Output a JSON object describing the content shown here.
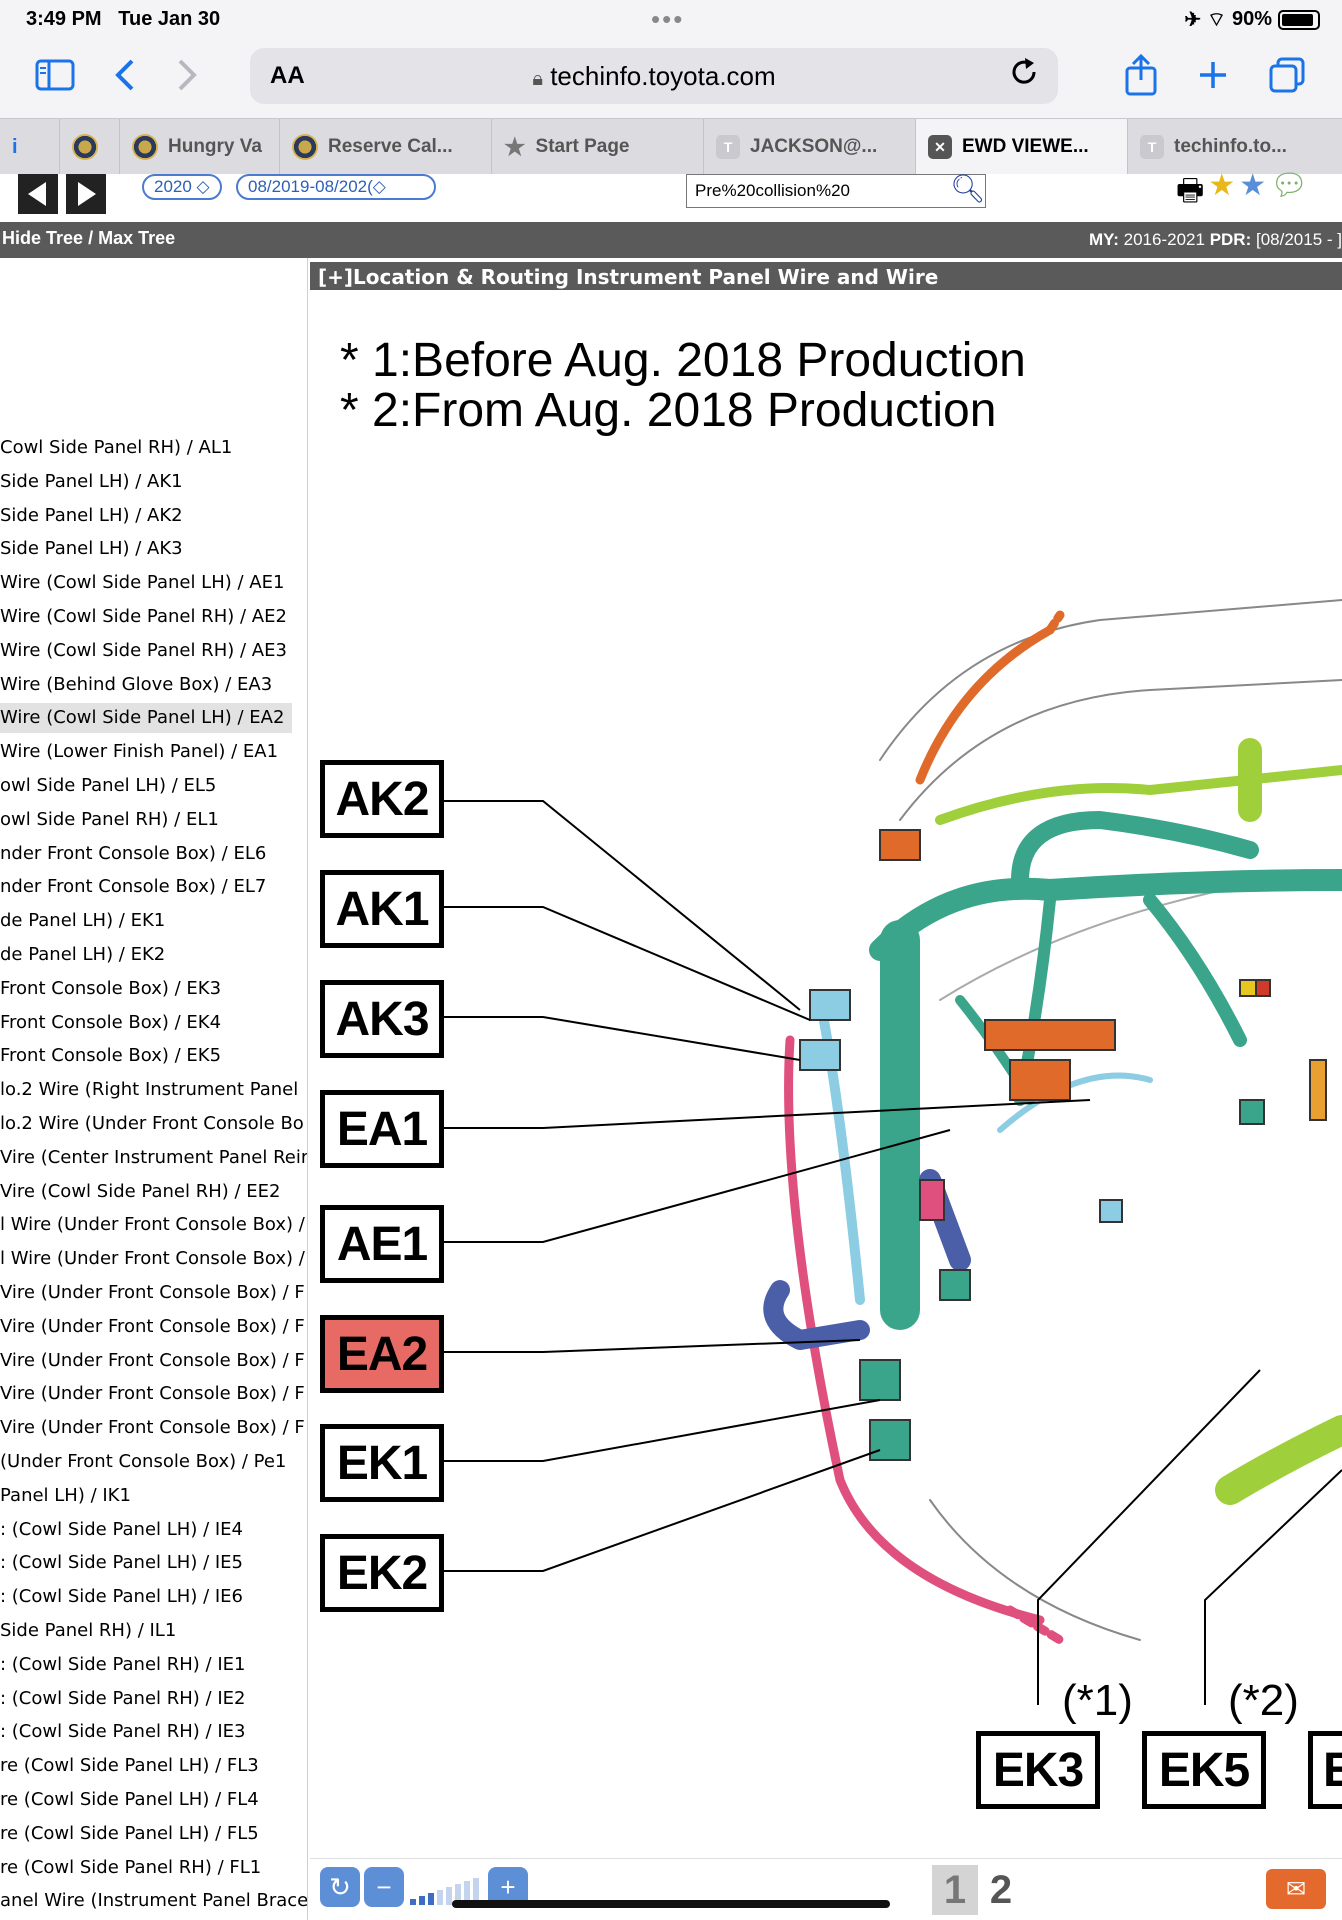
{
  "status_bar": {
    "time": "3:49 PM",
    "date": "Tue Jan 30",
    "battery": "90%",
    "battery_level": 0.9
  },
  "browser": {
    "text_size_label": "AA",
    "url": "techinfo.toyota.com",
    "tabs": [
      {
        "label": "Hungry Va"
      },
      {
        "label": "Reserve Cal..."
      },
      {
        "label": "Start Page"
      },
      {
        "label": "JACKSON@..."
      },
      {
        "label": "EWD VIEWE..."
      },
      {
        "label": "techinfo.to..."
      }
    ]
  },
  "app_nav": {
    "year": "2020 ◇",
    "range": "08/2019-08/202(◇",
    "search_value": "Pre%20collision%20"
  },
  "tree_bar": {
    "hide_tree": "Hide Tree",
    "separator": "/",
    "max_tree": "Max Tree",
    "my_label": "MY:",
    "my_value": "2016-2021",
    "pdr_label": "PDR:",
    "pdr_value": "[08/2015 - ]"
  },
  "sidebar": {
    "items": [
      "Cowl Side Panel RH) / AL1",
      "Side Panel LH) / AK1",
      "Side Panel LH) / AK2",
      "Side Panel LH) / AK3",
      " Wire (Cowl Side Panel LH) / AE1",
      " Wire (Cowl Side Panel RH) / AE2",
      " Wire (Cowl Side Panel RH) / AE3",
      " Wire (Behind Glove Box) / EA3",
      " Wire (Cowl Side Panel LH) / EA2",
      " Wire (Lower Finish Panel) / EA1",
      "owl Side Panel LH) / EL5",
      "owl Side Panel RH) / EL1",
      "nder Front Console Box) / EL6",
      "nder Front Console Box) / EL7",
      "de Panel LH) / EK1",
      "de Panel LH) / EK2",
      "Front Console Box) / EK3",
      "Front Console Box) / EK4",
      "Front Console Box) / EK5",
      "lo.2 Wire (Right Instrument Panel",
      "lo.2 Wire (Under Front Console Bo",
      "Vire (Center Instrument Panel Reir",
      "Vire (Cowl Side Panel RH) / EE2",
      "l Wire (Under Front Console Box) /",
      "l Wire (Under Front Console Box) /",
      "Vire (Under Front Console Box) / F",
      "Vire (Under Front Console Box) / F",
      "Vire (Under Front Console Box) / F",
      "Vire (Under Front Console Box) / F",
      "Vire (Under Front Console Box) / F",
      "(Under Front Console Box) / Pe1",
      " Panel LH) / IK1",
      ": (Cowl Side Panel LH) / IE4",
      ": (Cowl Side Panel LH) / IE5",
      ": (Cowl Side Panel LH) / IE6",
      " Side Panel RH) / IL1",
      ": (Cowl Side Panel RH) / IE1",
      ": (Cowl Side Panel RH) / IE2",
      ": (Cowl Side Panel RH) / IE3",
      "re (Cowl Side Panel LH) / FL3",
      "re (Cowl Side Panel LH) / FL4",
      "re (Cowl Side Panel LH) / FL5",
      "re (Cowl Side Panel RH) / FL1",
      "anel Wire (Instrument Panel Brace"
    ],
    "selected_index": 8
  },
  "content": {
    "title": "[+]Location & Routing  Instrument Panel  Wire and Wire",
    "note1": "* 1:Before Aug. 2018 Production",
    "note2": "* 2:From Aug. 2018 Production",
    "labels": [
      "AK2",
      "AK1",
      "AK3",
      "EA1",
      "AE1",
      "EA2",
      "EK1",
      "EK2"
    ],
    "highlighted_label": "EA2",
    "bottom_labels": [
      "EK3",
      "EK5",
      "E"
    ],
    "variant1": "(*1)",
    "variant2": "(*2)",
    "colors": {
      "highlight": "#e86a65",
      "harness_green": "#3aa58a",
      "harness_lime": "#9fcf3a",
      "harness_pink": "#e0507e",
      "harness_blue": "#8ccde3",
      "harness_orange": "#e06a2a"
    }
  },
  "footer": {
    "pages": [
      "1",
      "2"
    ],
    "current_page": "1",
    "zoom_level_fraction": 0.4
  }
}
